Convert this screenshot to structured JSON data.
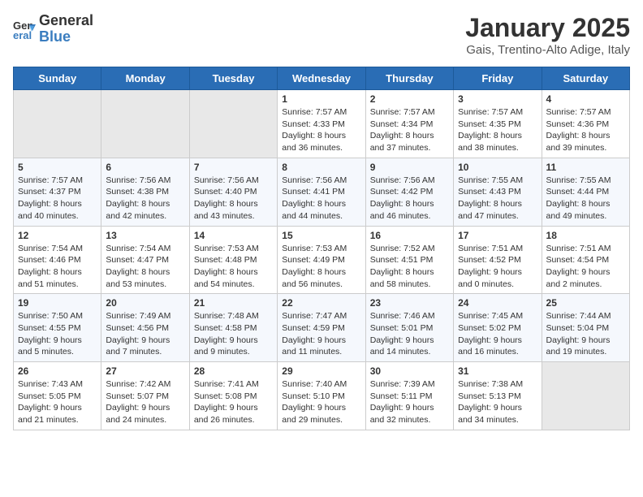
{
  "logo": {
    "general": "General",
    "blue": "Blue"
  },
  "header": {
    "month": "January 2025",
    "location": "Gais, Trentino-Alto Adige, Italy"
  },
  "weekdays": [
    "Sunday",
    "Monday",
    "Tuesday",
    "Wednesday",
    "Thursday",
    "Friday",
    "Saturday"
  ],
  "weeks": [
    [
      {
        "day": "",
        "info": ""
      },
      {
        "day": "",
        "info": ""
      },
      {
        "day": "",
        "info": ""
      },
      {
        "day": "1",
        "info": "Sunrise: 7:57 AM\nSunset: 4:33 PM\nDaylight: 8 hours and 36 minutes."
      },
      {
        "day": "2",
        "info": "Sunrise: 7:57 AM\nSunset: 4:34 PM\nDaylight: 8 hours and 37 minutes."
      },
      {
        "day": "3",
        "info": "Sunrise: 7:57 AM\nSunset: 4:35 PM\nDaylight: 8 hours and 38 minutes."
      },
      {
        "day": "4",
        "info": "Sunrise: 7:57 AM\nSunset: 4:36 PM\nDaylight: 8 hours and 39 minutes."
      }
    ],
    [
      {
        "day": "5",
        "info": "Sunrise: 7:57 AM\nSunset: 4:37 PM\nDaylight: 8 hours and 40 minutes."
      },
      {
        "day": "6",
        "info": "Sunrise: 7:56 AM\nSunset: 4:38 PM\nDaylight: 8 hours and 42 minutes."
      },
      {
        "day": "7",
        "info": "Sunrise: 7:56 AM\nSunset: 4:40 PM\nDaylight: 8 hours and 43 minutes."
      },
      {
        "day": "8",
        "info": "Sunrise: 7:56 AM\nSunset: 4:41 PM\nDaylight: 8 hours and 44 minutes."
      },
      {
        "day": "9",
        "info": "Sunrise: 7:56 AM\nSunset: 4:42 PM\nDaylight: 8 hours and 46 minutes."
      },
      {
        "day": "10",
        "info": "Sunrise: 7:55 AM\nSunset: 4:43 PM\nDaylight: 8 hours and 47 minutes."
      },
      {
        "day": "11",
        "info": "Sunrise: 7:55 AM\nSunset: 4:44 PM\nDaylight: 8 hours and 49 minutes."
      }
    ],
    [
      {
        "day": "12",
        "info": "Sunrise: 7:54 AM\nSunset: 4:46 PM\nDaylight: 8 hours and 51 minutes."
      },
      {
        "day": "13",
        "info": "Sunrise: 7:54 AM\nSunset: 4:47 PM\nDaylight: 8 hours and 53 minutes."
      },
      {
        "day": "14",
        "info": "Sunrise: 7:53 AM\nSunset: 4:48 PM\nDaylight: 8 hours and 54 minutes."
      },
      {
        "day": "15",
        "info": "Sunrise: 7:53 AM\nSunset: 4:49 PM\nDaylight: 8 hours and 56 minutes."
      },
      {
        "day": "16",
        "info": "Sunrise: 7:52 AM\nSunset: 4:51 PM\nDaylight: 8 hours and 58 minutes."
      },
      {
        "day": "17",
        "info": "Sunrise: 7:51 AM\nSunset: 4:52 PM\nDaylight: 9 hours and 0 minutes."
      },
      {
        "day": "18",
        "info": "Sunrise: 7:51 AM\nSunset: 4:54 PM\nDaylight: 9 hours and 2 minutes."
      }
    ],
    [
      {
        "day": "19",
        "info": "Sunrise: 7:50 AM\nSunset: 4:55 PM\nDaylight: 9 hours and 5 minutes."
      },
      {
        "day": "20",
        "info": "Sunrise: 7:49 AM\nSunset: 4:56 PM\nDaylight: 9 hours and 7 minutes."
      },
      {
        "day": "21",
        "info": "Sunrise: 7:48 AM\nSunset: 4:58 PM\nDaylight: 9 hours and 9 minutes."
      },
      {
        "day": "22",
        "info": "Sunrise: 7:47 AM\nSunset: 4:59 PM\nDaylight: 9 hours and 11 minutes."
      },
      {
        "day": "23",
        "info": "Sunrise: 7:46 AM\nSunset: 5:01 PM\nDaylight: 9 hours and 14 minutes."
      },
      {
        "day": "24",
        "info": "Sunrise: 7:45 AM\nSunset: 5:02 PM\nDaylight: 9 hours and 16 minutes."
      },
      {
        "day": "25",
        "info": "Sunrise: 7:44 AM\nSunset: 5:04 PM\nDaylight: 9 hours and 19 minutes."
      }
    ],
    [
      {
        "day": "26",
        "info": "Sunrise: 7:43 AM\nSunset: 5:05 PM\nDaylight: 9 hours and 21 minutes."
      },
      {
        "day": "27",
        "info": "Sunrise: 7:42 AM\nSunset: 5:07 PM\nDaylight: 9 hours and 24 minutes."
      },
      {
        "day": "28",
        "info": "Sunrise: 7:41 AM\nSunset: 5:08 PM\nDaylight: 9 hours and 26 minutes."
      },
      {
        "day": "29",
        "info": "Sunrise: 7:40 AM\nSunset: 5:10 PM\nDaylight: 9 hours and 29 minutes."
      },
      {
        "day": "30",
        "info": "Sunrise: 7:39 AM\nSunset: 5:11 PM\nDaylight: 9 hours and 32 minutes."
      },
      {
        "day": "31",
        "info": "Sunrise: 7:38 AM\nSunset: 5:13 PM\nDaylight: 9 hours and 34 minutes."
      },
      {
        "day": "",
        "info": ""
      }
    ]
  ]
}
